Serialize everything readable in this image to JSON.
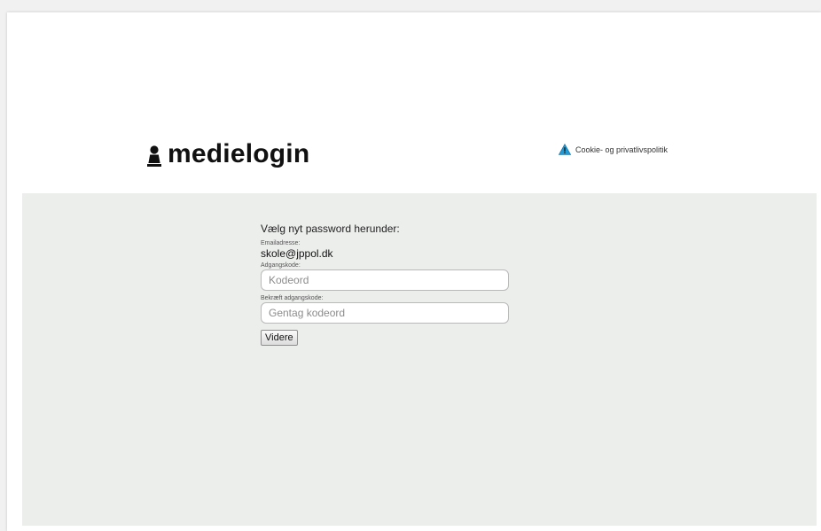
{
  "header": {
    "logo_text": "medielogin",
    "logo_icon": "person-icon",
    "privacy_link_label": "Cookie- og privatlivspolitik",
    "privacy_link_icon": "warning-icon"
  },
  "form": {
    "title": "Vælg nyt password herunder:",
    "email_label": "Emailadresse:",
    "email_value": "skole@jppol.dk",
    "password_label": "Adgangskode:",
    "password_placeholder": "Kodeord",
    "password_value": "",
    "confirm_label": "Bekræft adgangskode:",
    "confirm_placeholder": "Gentag kodeord",
    "confirm_value": "",
    "submit_label": "Videre"
  },
  "colors": {
    "page_background": "#f1f1f1",
    "header_background": "#ffffff",
    "content_background": "#eceeec",
    "warning_icon": "#1e9ad6"
  }
}
